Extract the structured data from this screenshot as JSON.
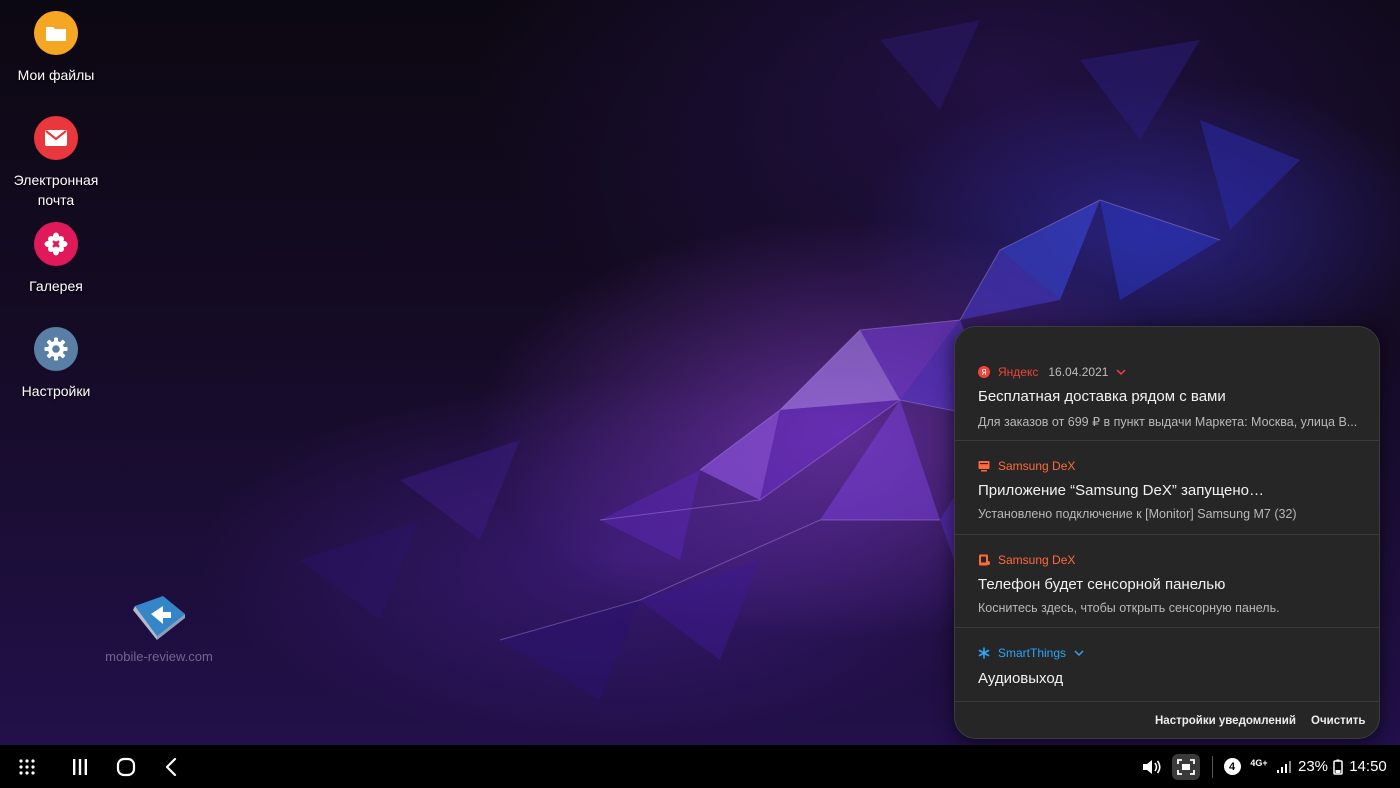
{
  "desktop": {
    "icons": [
      {
        "label": "Мои файлы",
        "icon": "folder-icon",
        "color": "#f5a623"
      },
      {
        "label": "Электронная почта",
        "icon": "mail-icon",
        "color": "#e8383d"
      },
      {
        "label": "Галерея",
        "icon": "gallery-flower-icon",
        "color": "#e0195a"
      },
      {
        "label": "Настройки",
        "icon": "gear-icon",
        "color": "#5a7fa5"
      }
    ],
    "watermark": "mobile-review.com"
  },
  "notifications": {
    "items": [
      {
        "app": "Яндекс",
        "app_icon": "yandex-icon",
        "app_color": "#f0443a",
        "date": "16.04.2021",
        "title": "Бесплатная доставка рядом с вами",
        "body": "Для заказов от 699 ₽ в пункт выдачи Маркета: Москва, улица В..."
      },
      {
        "app": "Samsung DeX",
        "app_icon": "dex-monitor-icon",
        "app_color": "#ff6a3d",
        "title": "Приложение “Samsung DeX” запущено…",
        "body": "Установлено подключение к [Monitor] Samsung M7 (32)"
      },
      {
        "app": "Samsung DeX",
        "app_icon": "dex-touchpad-icon",
        "app_color": "#ff6a3d",
        "title": "Телефон будет сенсорной панелью",
        "body": "Коснитесь здесь, чтобы открыть сенсорную панель."
      },
      {
        "app": "SmartThings",
        "app_icon": "smartthings-icon",
        "app_color": "#2fa3f5",
        "title": "Аудиовыход"
      }
    ],
    "footer": {
      "settings_label": "Настройки уведомлений",
      "clear_label": "Очистить"
    }
  },
  "taskbar": {
    "notification_count": "4",
    "network": "4G+",
    "battery": "23%",
    "time": "14:50"
  }
}
